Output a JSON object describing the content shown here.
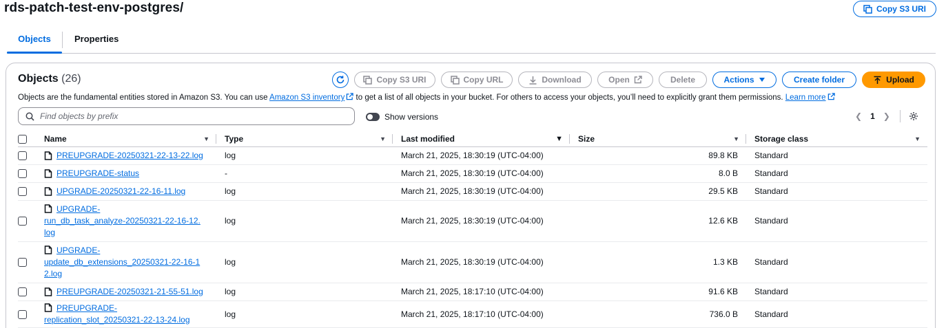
{
  "page": {
    "title": "rds-patch-test-env-postgres/",
    "copy_s3_uri_label": "Copy S3 URI"
  },
  "tabs": [
    {
      "label": "Objects"
    },
    {
      "label": "Properties"
    }
  ],
  "panel": {
    "title": "Objects",
    "count": "(26)",
    "buttons": {
      "copy_s3_uri": "Copy S3 URI",
      "copy_url": "Copy URL",
      "download": "Download",
      "open": "Open",
      "delete": "Delete",
      "actions": "Actions",
      "create_folder": "Create folder",
      "upload": "Upload"
    },
    "description": {
      "part1": "Objects are the fundamental entities stored in Amazon S3. You can use ",
      "link1": "Amazon S3 inventory",
      "part2": " to get a list of all objects in your bucket. For others to access your objects, you’ll need to explicitly grant them permissions. ",
      "link2": "Learn more"
    },
    "search": {
      "placeholder": "Find objects by prefix"
    },
    "show_versions": "Show versions",
    "pagination": {
      "current": "1"
    }
  },
  "table": {
    "columns": [
      "Name",
      "Type",
      "Last modified",
      "Size",
      "Storage class"
    ],
    "rows": [
      {
        "name_lines": [
          "PREUPGRADE-20250321-22-13-22.log"
        ],
        "type": "log",
        "last_modified": "March 21, 2025, 18:30:19 (UTC-04:00)",
        "size": "89.8 KB",
        "storage_class": "Standard"
      },
      {
        "name_lines": [
          "PREUPGRADE-status"
        ],
        "type": "-",
        "last_modified": "March 21, 2025, 18:30:19 (UTC-04:00)",
        "size": "8.0 B",
        "storage_class": "Standard"
      },
      {
        "name_lines": [
          "UPGRADE-20250321-22-16-11.log"
        ],
        "type": "log",
        "last_modified": "March 21, 2025, 18:30:19 (UTC-04:00)",
        "size": "29.5 KB",
        "storage_class": "Standard"
      },
      {
        "name_lines": [
          "UPGRADE-",
          "run_db_task_analyze-20250321-22-16-12.",
          "log"
        ],
        "type": "log",
        "last_modified": "March 21, 2025, 18:30:19 (UTC-04:00)",
        "size": "12.6 KB",
        "storage_class": "Standard"
      },
      {
        "name_lines": [
          "UPGRADE-",
          "update_db_extensions_20250321-22-16-1",
          "2.log"
        ],
        "type": "log",
        "last_modified": "March 21, 2025, 18:30:19 (UTC-04:00)",
        "size": "1.3 KB",
        "storage_class": "Standard"
      },
      {
        "name_lines": [
          "PREUPGRADE-20250321-21-55-51.log"
        ],
        "type": "log",
        "last_modified": "March 21, 2025, 18:17:10 (UTC-04:00)",
        "size": "91.6 KB",
        "storage_class": "Standard"
      },
      {
        "name_lines": [
          "PREUPGRADE-",
          "replication_slot_20250321-22-13-24.log"
        ],
        "type": "log",
        "last_modified": "March 21, 2025, 18:17:10 (UTC-04:00)",
        "size": "736.0 B",
        "storage_class": "Standard"
      }
    ]
  }
}
